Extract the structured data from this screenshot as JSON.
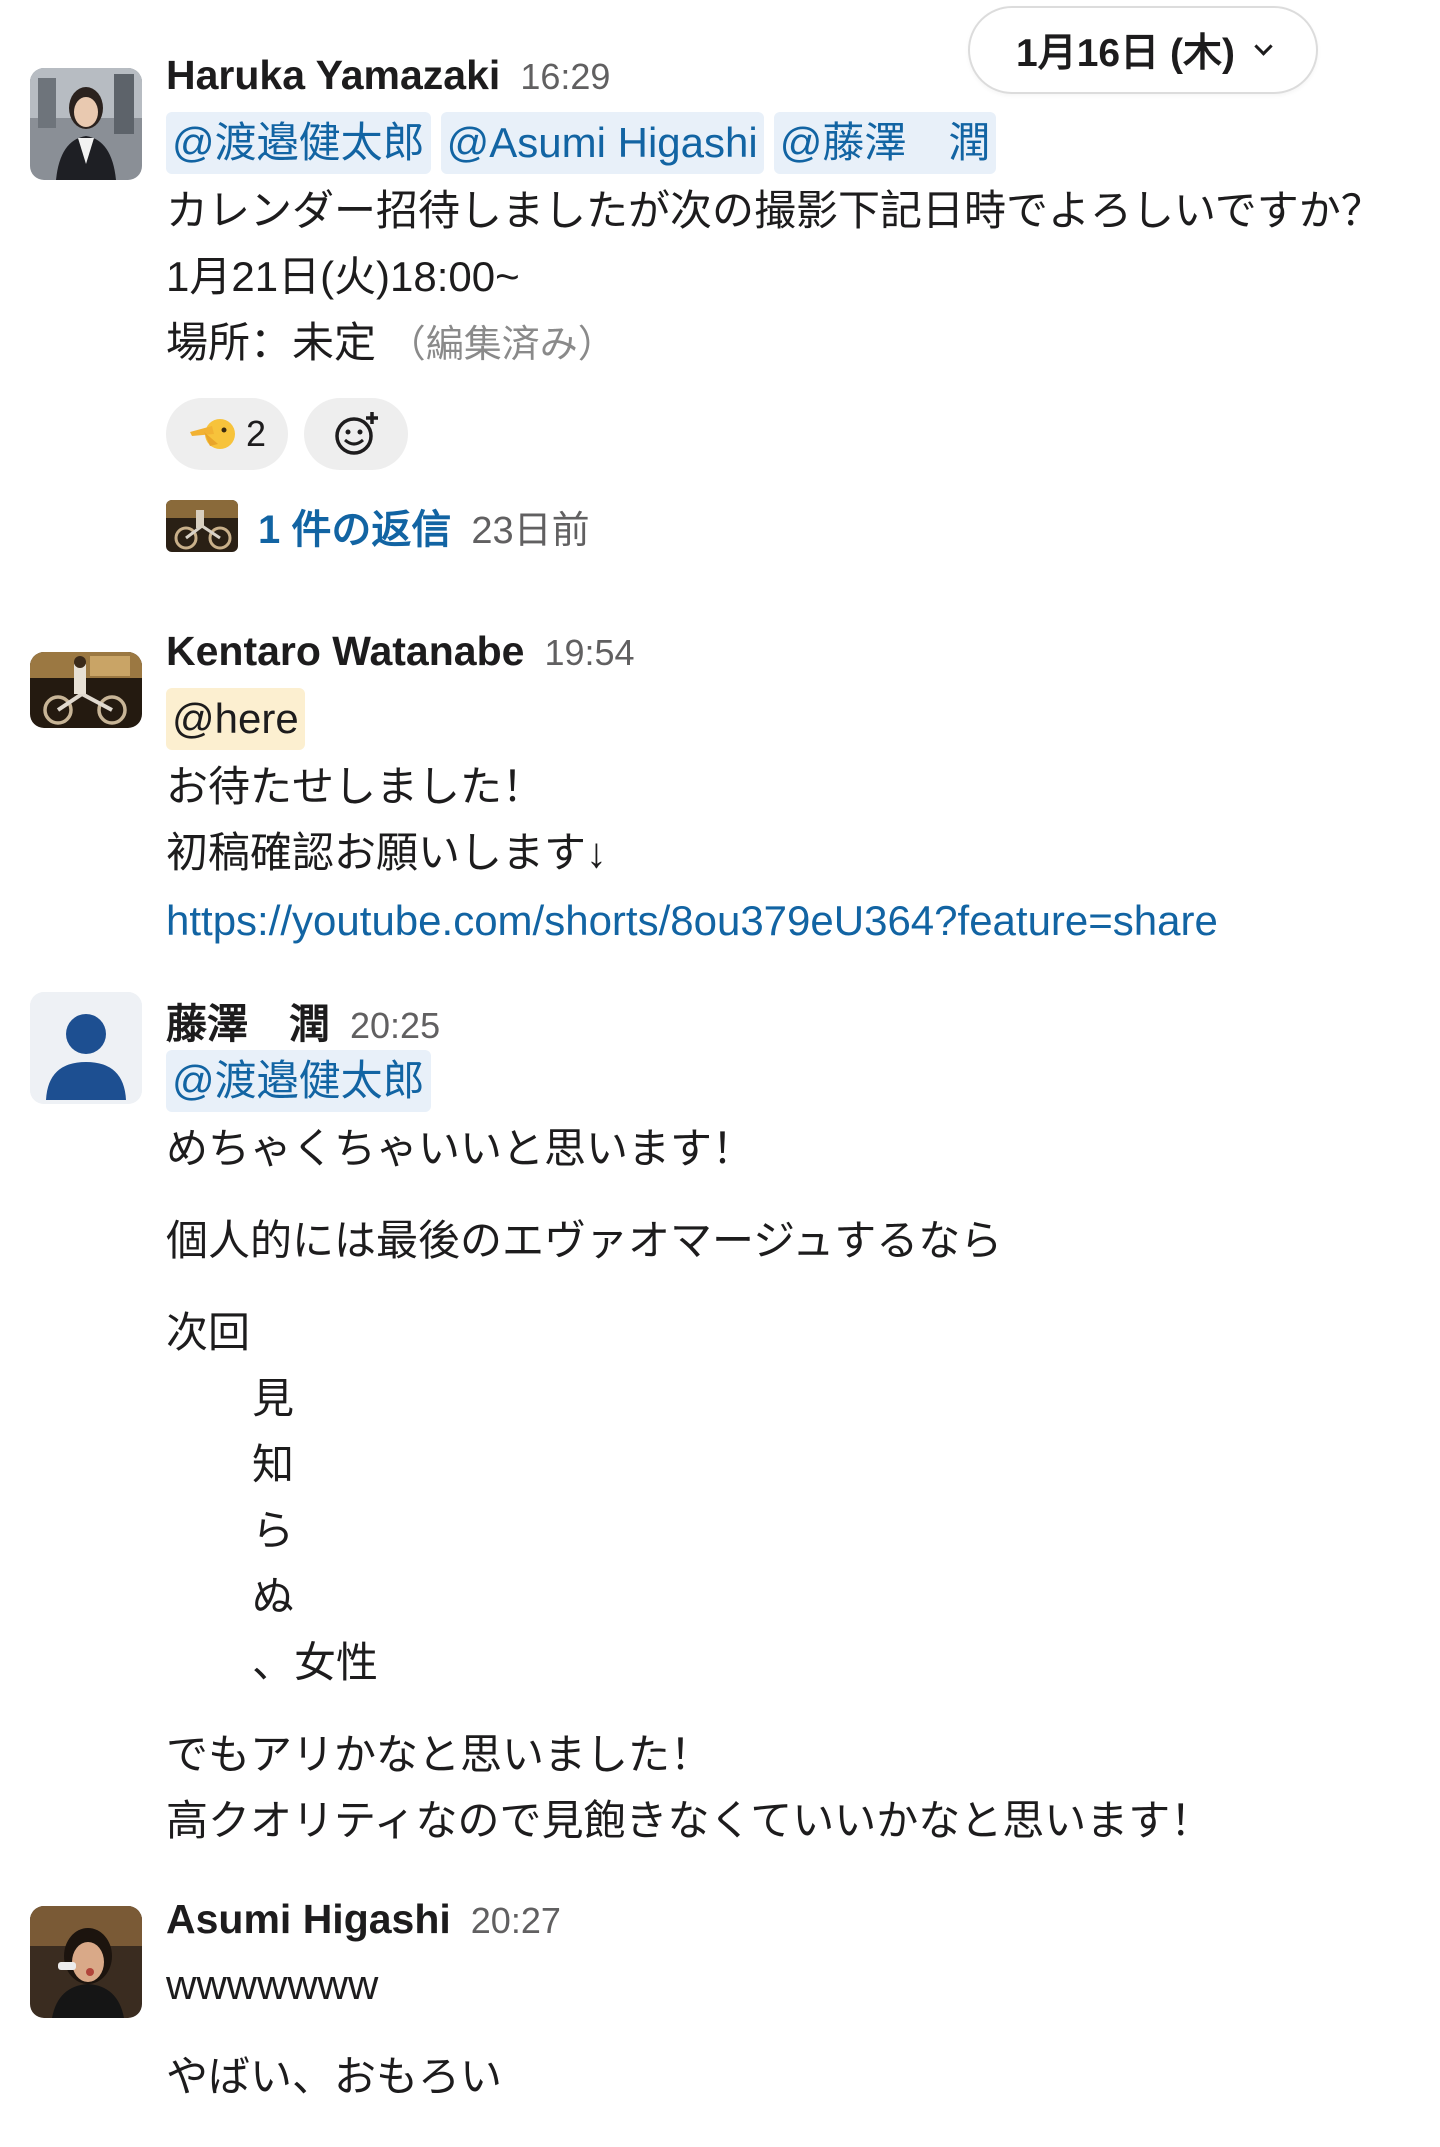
{
  "date_divider": {
    "label": "1月16日 (木)"
  },
  "messages": [
    {
      "name": "Haruka Yamazaki",
      "time": "16:29",
      "mentions": [
        "@渡邉健太郎",
        "@Asumi Higashi",
        "@藤澤　潤"
      ],
      "lines": [
        "カレンダー招待しましたが次の撮影下記日時でよろしいですか？",
        "1月21日(火)18:00~",
        "場所：未定"
      ],
      "edited": "（編集済み）",
      "reaction": {
        "icon": "pointing-hand-emoji",
        "count": "2"
      },
      "add_reaction_icon": "add-reaction-icon",
      "thread": {
        "replies": "1 件の返信",
        "ago": "23日前"
      }
    },
    {
      "name": "Kentaro Watanabe",
      "time": "19:54",
      "here": "@here",
      "lines": [
        "お待たせしました！",
        "初稿確認お願いします↓"
      ],
      "link": "https://youtube.com/shorts/8ou379eU364?feature=share"
    },
    {
      "name": "藤澤　潤",
      "time": "20:25",
      "mention": "@渡邉健太郎",
      "lines": [
        "めちゃくちゃいいと思います！",
        "個人的には最後のエヴァオマージュするなら",
        "次回",
        "見",
        "知",
        "ら",
        "ぬ",
        "、女性",
        "でもアリかなと思いました！",
        "高クオリティなので見飽きなくていいかなと思います！"
      ]
    },
    {
      "name": "Asumi Higashi",
      "time": "20:27",
      "lines": [
        "wwwwwww",
        "やばい、おもろい"
      ]
    }
  ],
  "colors": {
    "link": "#1264a3",
    "mention_bg": "#e8f0f9",
    "here_bg": "#fcefd0",
    "text": "#1d1c1d",
    "muted": "#616061",
    "default_avatar": "#1d4f91"
  }
}
